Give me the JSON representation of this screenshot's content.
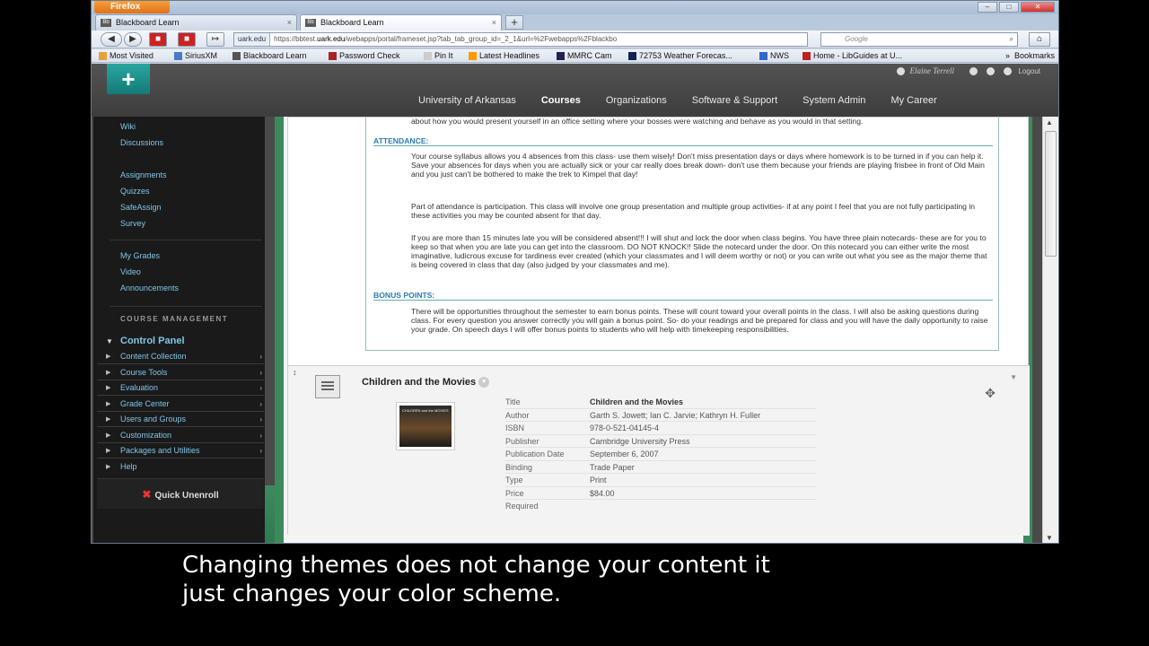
{
  "browser": {
    "app_button": "Firefox",
    "tabs": [
      {
        "label": "Blackboard Learn",
        "favicon": "Bb",
        "active": false
      },
      {
        "label": "Blackboard Learn",
        "favicon": "Bb",
        "active": true
      }
    ],
    "url_site": "uark.edu",
    "url_prefix": "https://bbtest.",
    "url_domain": "uark.edu",
    "url_rest": "/webapps/portal/frameset.jsp?tab_tab_group_id=_2_1&url=%2Fwebapps%2Fblackbo",
    "search_placeholder": "Google",
    "bookmarks": [
      "Most Visited",
      "SiriusXM",
      "Blackboard Learn",
      "Password Check",
      "Pin It",
      "Latest Headlines",
      "MMRC Cam",
      "72753 Weather Forecas...",
      "NWS",
      "Home - LibGuides at U..."
    ],
    "bookmarks_overflow": "»",
    "bookmarks_menu": "Bookmarks"
  },
  "bb": {
    "user_name": "Elaine Terrell",
    "logout": "Logout",
    "plus_label": "+",
    "topnav": [
      {
        "label": "University of Arkansas",
        "active": false
      },
      {
        "label": "Courses",
        "active": true
      },
      {
        "label": "Organizations",
        "active": false
      },
      {
        "label": "Software & Support",
        "active": false
      },
      {
        "label": "System Admin",
        "active": false
      },
      {
        "label": "My Career",
        "active": false
      }
    ],
    "course_menu": [
      "Wiki",
      "Discussions",
      "Assignments",
      "Quizzes",
      "SafeAssign",
      "Survey"
    ],
    "course_menu_2": [
      "My Grades",
      "Video",
      "Announcements"
    ],
    "course_management_heading": "COURSE MANAGEMENT",
    "control_panel": "Control Panel",
    "control_panel_items": [
      "Content Collection",
      "Course Tools",
      "Evaluation",
      "Grade Center",
      "Users and Groups",
      "Customization",
      "Packages and Utilities",
      "Help"
    ],
    "quick_unenroll": "Quick Unenroll"
  },
  "syllabus": {
    "intro_tail": "about how you would present yourself in an office setting where your bosses were watching and behave as you would in that setting.",
    "attendance_heading": "ATTENDANCE:",
    "attendance_p1": "Your course syllabus allows you 4 absences from this class- use them wisely! Don't miss presentation days or days where homework is to be turned in if you can help it. Save your absences for days when you are actually sick or your car really does break down- don't use them because your friends are playing frisbee in front of Old Main and you just can't be bothered to make the trek to Kimpel that day!",
    "attendance_p2": "Part of attendance is participation. This class will involve one group presentation and multiple group activities- if at any point I feel that you are not fully participating in these activities you may be counted absent for that day.",
    "attendance_p3": "If you are more than 15 minutes late you will be considered absent!!! I will shut and lock the door when class begins. You have three plain notecards- these are for you to keep so that when you are late you can get into the classroom. DO NOT KNOCK!! Slide the notecard under the door. On this notecard you can either write the most imaginative, ludicrous excuse for tardiness ever created (which your classmates and I will deem worthy or not) or you can write out what you see as the major theme that is being covered in class that day (also judged by your classmates and me).",
    "bonus_heading": "BONUS POINTS:",
    "bonus_p1": "There will be opportunities throughout the semester to earn bonus points. These will count toward your overall points in the class. I will also be asking questions during class. For every question you answer correctly you will gain a bonus point. So- do your readings and be prepared for class and you will have the daily opportunity to raise your grade. On speech days I will offer bonus points to students who will help with timekeeping responsibilities."
  },
  "book_item": {
    "title": "Children and the Movies",
    "cover_text": "CHILDREN and the MOVIES",
    "details": [
      {
        "key": "Title",
        "value": "Children and the Movies"
      },
      {
        "key": "Author",
        "value": "Garth S. Jowett; Ian C. Jarvie; Kathryn H. Fuller"
      },
      {
        "key": "ISBN",
        "value": "978-0-521-04145-4"
      },
      {
        "key": "Publisher",
        "value": "Cambridge University Press"
      },
      {
        "key": "Publication Date",
        "value": "September 6, 2007"
      },
      {
        "key": "Binding",
        "value": "Trade Paper"
      },
      {
        "key": "Type",
        "value": "Print"
      },
      {
        "key": "Price",
        "value": "$84.00"
      },
      {
        "key": "Required",
        "value": ""
      }
    ]
  },
  "caption": {
    "line1": "Changing themes does not change your content it",
    "line2": "just changes your color scheme."
  },
  "colors": {
    "accent_teal": "#147a76",
    "link_blue": "#7fc6e8",
    "theme_green": "#3c8a5c",
    "heading_blue": "#2b7bb0"
  }
}
